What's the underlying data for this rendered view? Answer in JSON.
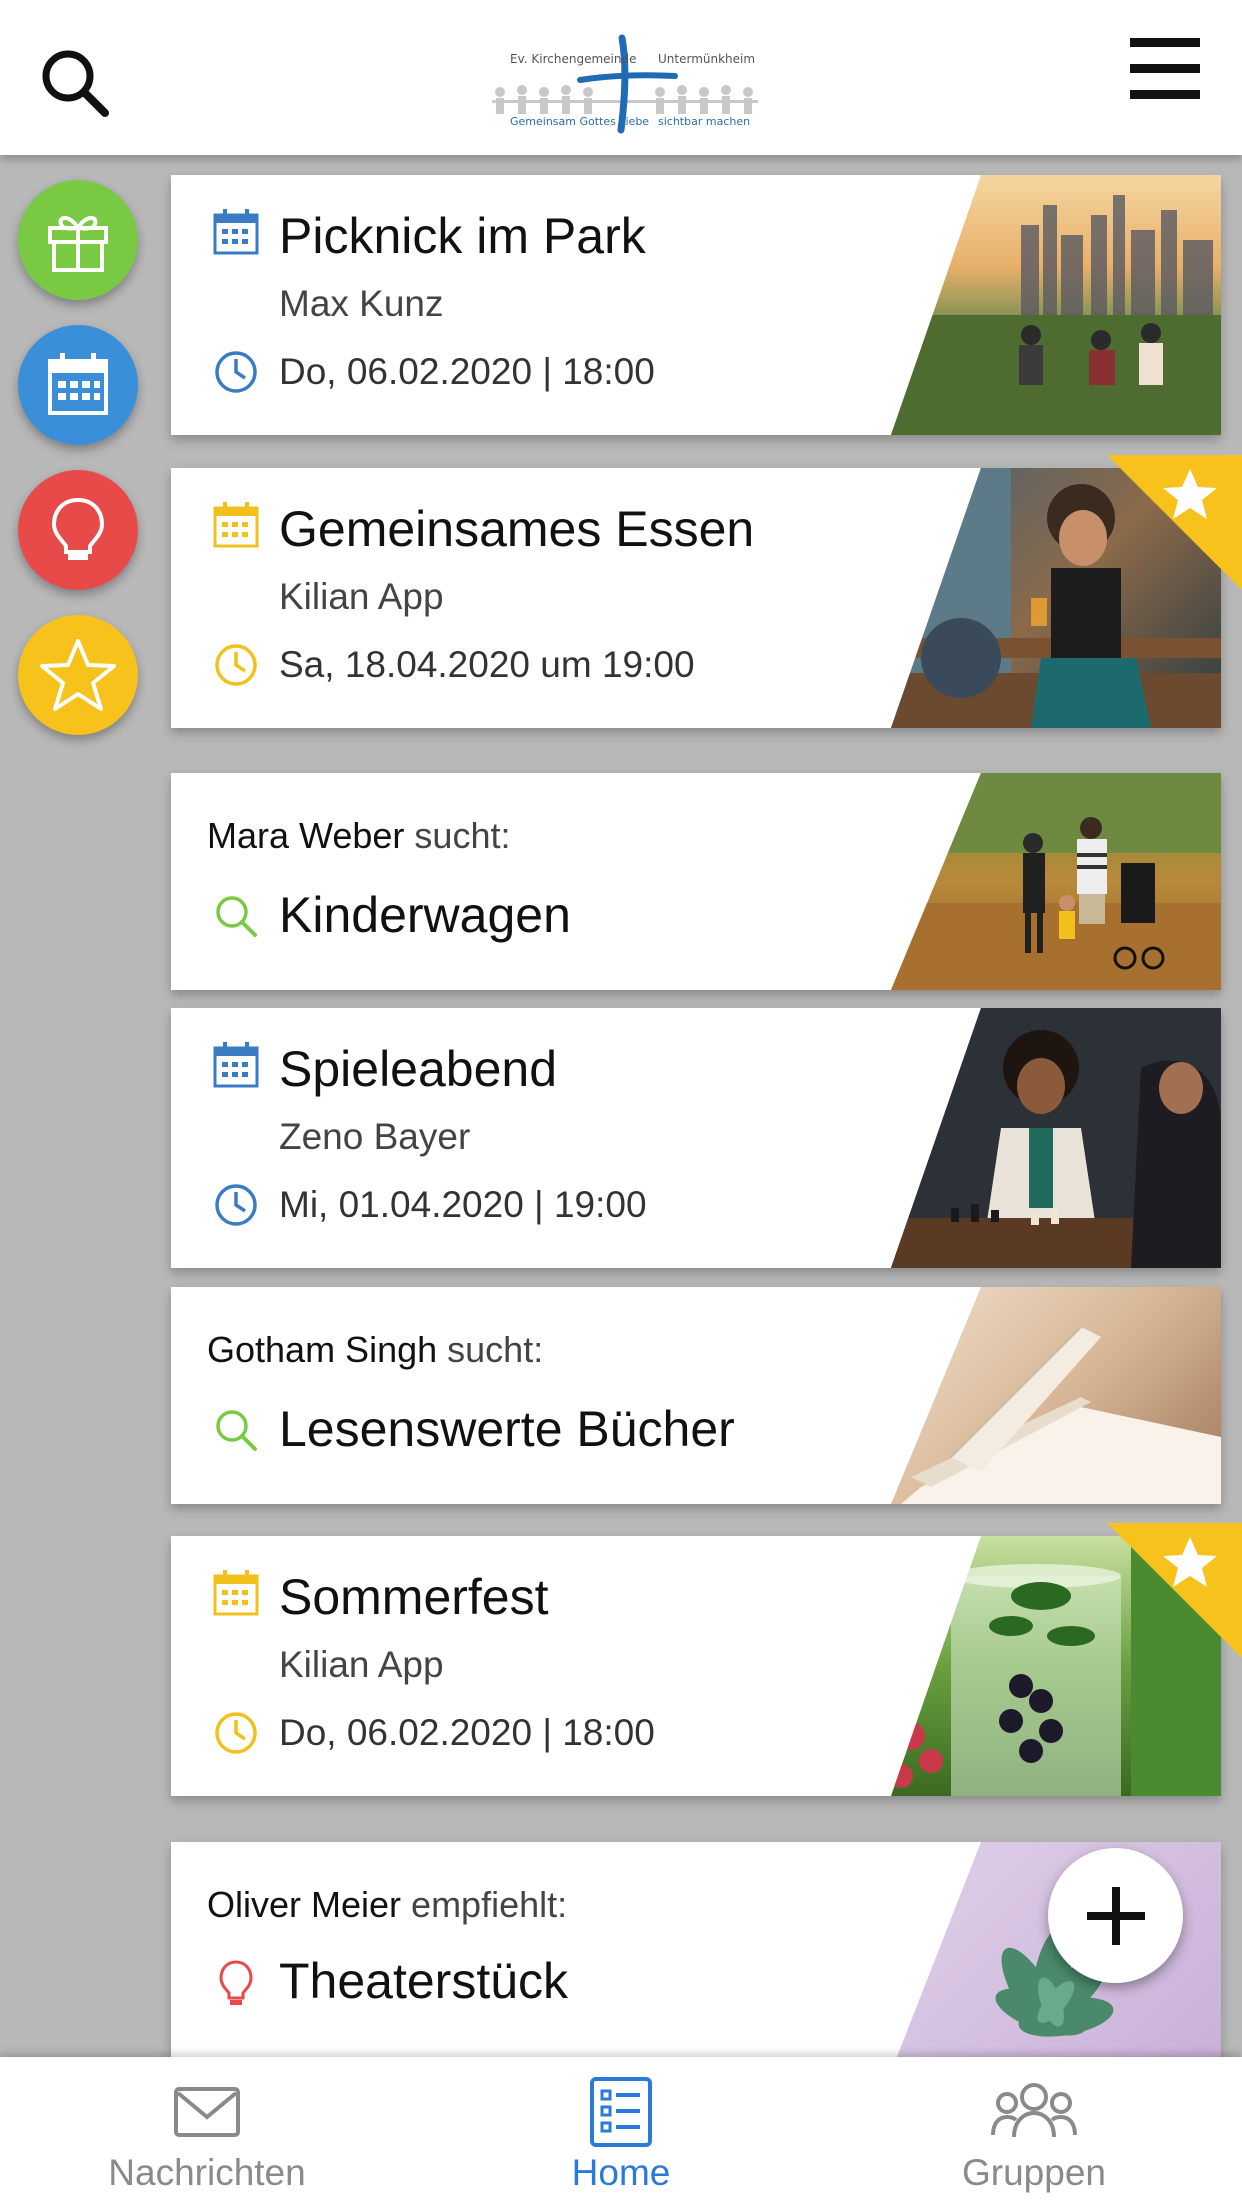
{
  "header": {
    "logo": {
      "left_text": "Ev. Kirchengemeinde",
      "right_text": "Untermünkheim",
      "tagline_left": "Gemeinsam Gottes Liebe",
      "tagline_right": "sichtbar machen"
    },
    "search_icon": "search-icon",
    "menu_icon": "hamburger-menu-icon"
  },
  "side_categories": [
    {
      "name": "gift",
      "icon": "gift-icon",
      "color": "#7ac943"
    },
    {
      "name": "calendar",
      "icon": "calendar-icon",
      "color": "#3a8fd8"
    },
    {
      "name": "idea",
      "icon": "lightbulb-icon",
      "color": "#e84a4a"
    },
    {
      "name": "favorites",
      "icon": "star-icon",
      "color": "#f7c21c"
    }
  ],
  "feed": [
    {
      "type": "event",
      "title": "Picknick im Park",
      "person": "Max Kunz",
      "datetime": "Do, 06.02.2020 | 18:00",
      "accent": "#3a7cc4",
      "featured": false
    },
    {
      "type": "event",
      "title": "Gemeinsames Essen",
      "person": "Kilian App",
      "datetime": "Sa, 18.04.2020 um 19:00",
      "accent": "#f2c01b",
      "featured": true
    },
    {
      "type": "search",
      "person": "Mara Weber",
      "verb": "sucht:",
      "title": "Kinderwagen",
      "accent": "#7ac943"
    },
    {
      "type": "event",
      "title": "Spieleabend",
      "person": "Zeno Bayer",
      "datetime": "Mi, 01.04.2020 | 19:00",
      "accent": "#3a7cc4",
      "featured": false
    },
    {
      "type": "search",
      "person": "Gotham Singh",
      "verb": "sucht:",
      "title": "Lesenswerte Bücher",
      "accent": "#7ac943"
    },
    {
      "type": "event",
      "title": "Sommerfest",
      "person": "Kilian App",
      "datetime": "Do, 06.02.2020 | 18:00",
      "accent": "#f2c01b",
      "featured": true
    },
    {
      "type": "recommend",
      "person": "Oliver Meier",
      "verb": "empfiehlt:",
      "title": "Theaterstück",
      "accent": "#e84a4a"
    }
  ],
  "fab": {
    "icon": "plus-icon"
  },
  "bottom_nav": [
    {
      "label": "Nachrichten",
      "icon": "envelope-icon",
      "active": false
    },
    {
      "label": "Home",
      "icon": "list-icon",
      "active": true
    },
    {
      "label": "Gruppen",
      "icon": "group-icon",
      "active": false
    }
  ],
  "colors": {
    "active_nav": "#2a7ad8",
    "inactive_nav": "#8a8a8a",
    "ribbon": "#f7c21c"
  }
}
